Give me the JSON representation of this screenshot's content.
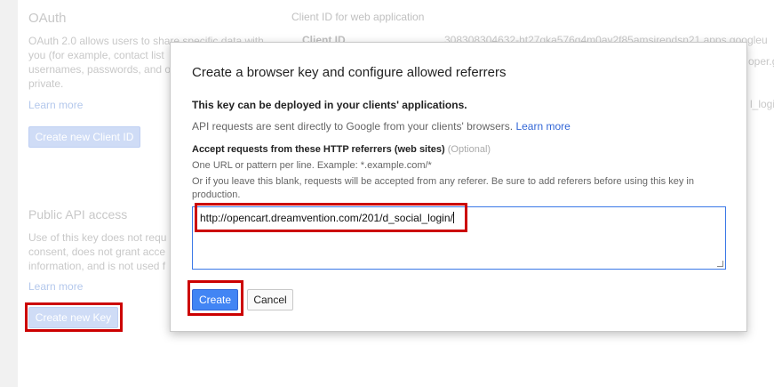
{
  "oauth": {
    "title": "OAuth",
    "description_lines": [
      "OAuth 2.0 allows users to share specific data with",
      "you (for example, contact list",
      "usernames, passwords, and o",
      "private."
    ],
    "learn_more": "Learn more",
    "create_client_button": "Create new Client ID"
  },
  "client_panel": {
    "header": "Client ID for web application",
    "client_id_label": "Client ID",
    "client_id_value": "308308304632-ht27gka576g4m0av2f85amsirendsn21.apps.googleu",
    "right_frag_1": "oper.g",
    "right_frag_2": "l_logi"
  },
  "public_api": {
    "title": "Public API access",
    "description_lines": [
      "Use of this key does not requ",
      "consent, does not grant acce",
      "information, and is not used f"
    ],
    "learn_more": "Learn more",
    "create_key_button": "Create new Key"
  },
  "dialog": {
    "title": "Create a browser key and configure allowed referrers",
    "bold_note": "This key can be deployed in your clients' applications.",
    "info_text": "API requests are sent directly to Google from your clients' browsers.",
    "info_link": "Learn more",
    "field_label": "Accept requests from these HTTP referrers (web sites)",
    "field_optional": "(Optional)",
    "hint_1": "One URL or pattern per line. Example: *.example.com/*",
    "hint_2a": "Or if you leave this blank, requests will be accepted from any referer. Be sure to add referers before using this key in",
    "hint_2b": "production.",
    "referrer_value": "http://opencart.dreamvention.com/201/d_social_login/",
    "create_button": "Create",
    "cancel_button": "Cancel"
  },
  "colors": {
    "primary": "#4285f4",
    "link": "#3367d6",
    "highlight": "#cc0000"
  }
}
